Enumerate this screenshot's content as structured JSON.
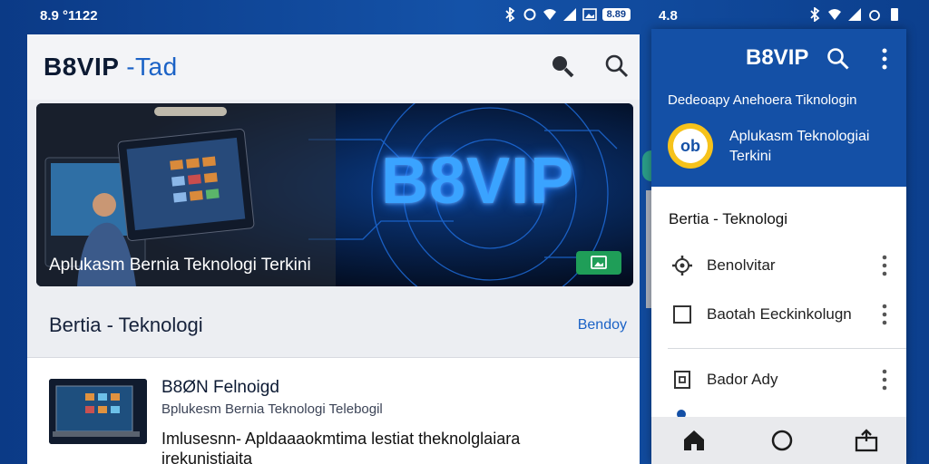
{
  "status_left": {
    "time": "8.9 °1122",
    "battery": "8.89"
  },
  "status_right": {
    "time": "4.8"
  },
  "app": {
    "title": "B8VIP",
    "title_accent": "-Tad",
    "banner_brand": "B8VIP",
    "banner_caption": "Aplukasm Bernia Teknologi Terkini",
    "section_title": "Bertia - Teknologi",
    "section_link": "Bendoy",
    "item": {
      "title": "B8ØN Felnoigd",
      "subtitle": "Bplukesm Bernia Teknologi Telebogil",
      "description": "Imlusesnn- Apldaaaokmtima lestiat theknolglaiara irekunistiaita"
    }
  },
  "drawer": {
    "title": "B8VIP",
    "subtitle": "Dedeoapy Anehoera Tiknologin",
    "logo_text": "ob",
    "app_name": "Aplukasm Teknologiai Terkini",
    "section": "Bertia - Teknologi",
    "items": [
      {
        "label": "Benolvitar",
        "icon": "gear-icon"
      },
      {
        "label": "Baotah Eeckinkolugn",
        "icon": "checkbox-icon"
      },
      {
        "label": "Bador Ady",
        "icon": "document-icon"
      }
    ]
  },
  "navbar": {
    "icons": [
      "home-icon",
      "circle-home-icon",
      "share-icon"
    ]
  },
  "colors": {
    "primary": "#1450a6",
    "accent": "#1b62c6",
    "banner_glow": "#3aa3ff",
    "badge": "#1f9e58"
  }
}
